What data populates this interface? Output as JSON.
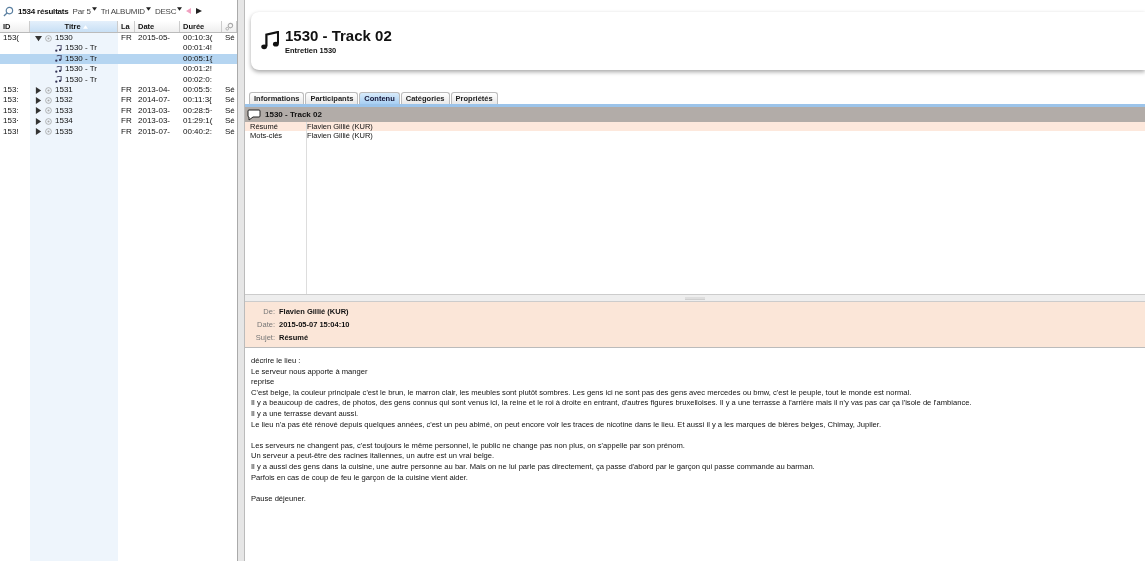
{
  "toolbar": {
    "results": "1534 résultats",
    "page_size": "Par 5",
    "sort": "Tri ALBUMID",
    "order": "DESC"
  },
  "table": {
    "columns": [
      {
        "label": "ID",
        "sorted": false
      },
      {
        "label": "Titre",
        "sorted": true
      },
      {
        "label": "La",
        "sorted": false
      },
      {
        "label": "Date",
        "sorted": false
      },
      {
        "label": "Durée",
        "sorted": false
      }
    ],
    "rows": [
      {
        "id": "153(",
        "title": "1530",
        "lang": "FR",
        "date": "2015-05-",
        "duration": "00:10:3(",
        "extra": "Sé",
        "expanded": true,
        "selected": false,
        "children": [
          {
            "title": "1530 - Tr",
            "duration": "00:01:4!",
            "selected": false
          },
          {
            "title": "1530 - Tr",
            "duration": "00:05:1{",
            "selected": true
          },
          {
            "title": "1530 - Tr",
            "duration": "00:01:2!",
            "selected": false
          },
          {
            "title": "1530 - Tr",
            "duration": "00:02:0:",
            "selected": false
          }
        ]
      },
      {
        "id": "153:",
        "title": "1531",
        "lang": "FR",
        "date": "2013-04-",
        "duration": "00:05:5:",
        "extra": "Sé",
        "expanded": false,
        "selected": false
      },
      {
        "id": "153:",
        "title": "1532",
        "lang": "FR",
        "date": "2014-07-",
        "duration": "00:11:3{",
        "extra": "Sé",
        "expanded": false,
        "selected": false
      },
      {
        "id": "153:",
        "title": "1533",
        "lang": "FR",
        "date": "2013-03-",
        "duration": "00:28:5·",
        "extra": "Sé",
        "expanded": false,
        "selected": false
      },
      {
        "id": "153·",
        "title": "1534",
        "lang": "FR",
        "date": "2013-03-",
        "duration": "01:29:1(",
        "extra": "Sé",
        "expanded": false,
        "selected": false
      },
      {
        "id": "153!",
        "title": "1535",
        "lang": "FR",
        "date": "2015-07-",
        "duration": "00:40:2:",
        "extra": "Sé",
        "expanded": false,
        "selected": false
      }
    ]
  },
  "header": {
    "title": "1530 - Track 02",
    "subtitle": "Entretien 1530"
  },
  "tabs": [
    {
      "label": "Informations",
      "selected": false
    },
    {
      "label": "Participants",
      "selected": false
    },
    {
      "label": "Contenu",
      "selected": true
    },
    {
      "label": "Catégories",
      "selected": false
    },
    {
      "label": "Propriétés",
      "selected": false
    }
  ],
  "content": {
    "title": "1530 - Track 02",
    "rows": [
      {
        "label": "Résumé",
        "value": "Flavien Gillié (KUR)",
        "selected": true
      },
      {
        "label": "Mots-clés",
        "value": "Flavien Gillié (KUR)",
        "selected": false
      }
    ]
  },
  "message": {
    "fields": [
      {
        "label": "De:",
        "value": "Flavien Gillié (KUR)"
      },
      {
        "label": "Date:",
        "value": "2015-05-07 15:04:10"
      },
      {
        "label": "Sujet:",
        "value": "Résumé"
      }
    ],
    "paragraphs": [
      [
        "décrire le lieu :",
        "Le serveur nous apporte à manger",
        "reprise",
        "C'est belge, la couleur principale c'est le brun, le marron clair, les meubles sont plutôt sombres. Les gens ici ne sont pas des gens avec mercedes ou bmw, c'est le peuple, tout le monde est normal.",
        "Il y a beaucoup de cadres, de photos, des gens connus qui sont venus ici, la reine et le roi à droite en entrant, d'autres figures bruxelloises. Il y a une terrasse à l'arrière mais il n'y vas pas car ça l'isole de l'ambiance.",
        "Il y a une terrasse devant aussi.",
        "Le lieu n'a pas été rénové depuis quelques années, c'est un peu abimé, on peut encore voir les traces de nicotine dans le lieu. Et aussi il y a les marques de bières belges, Chimay, Jupiler."
      ],
      [
        "Les serveurs ne changent pas, c'est toujours le même personnel, le public ne change pas non plus, on s'appelle par son prénom.",
        "Un serveur a peut-être des racines italiennes, un autre est un vrai belge.",
        "Il y a aussi des gens dans la cuisine, une autre personne au bar. Mais on ne lui parle pas directement, ça passe d'abord par le garçon qui passe commande au barman.",
        "Parfois en cas de coup de feu le garçon de la cuisine vient aider."
      ],
      [
        "Pause déjeuner."
      ]
    ]
  }
}
